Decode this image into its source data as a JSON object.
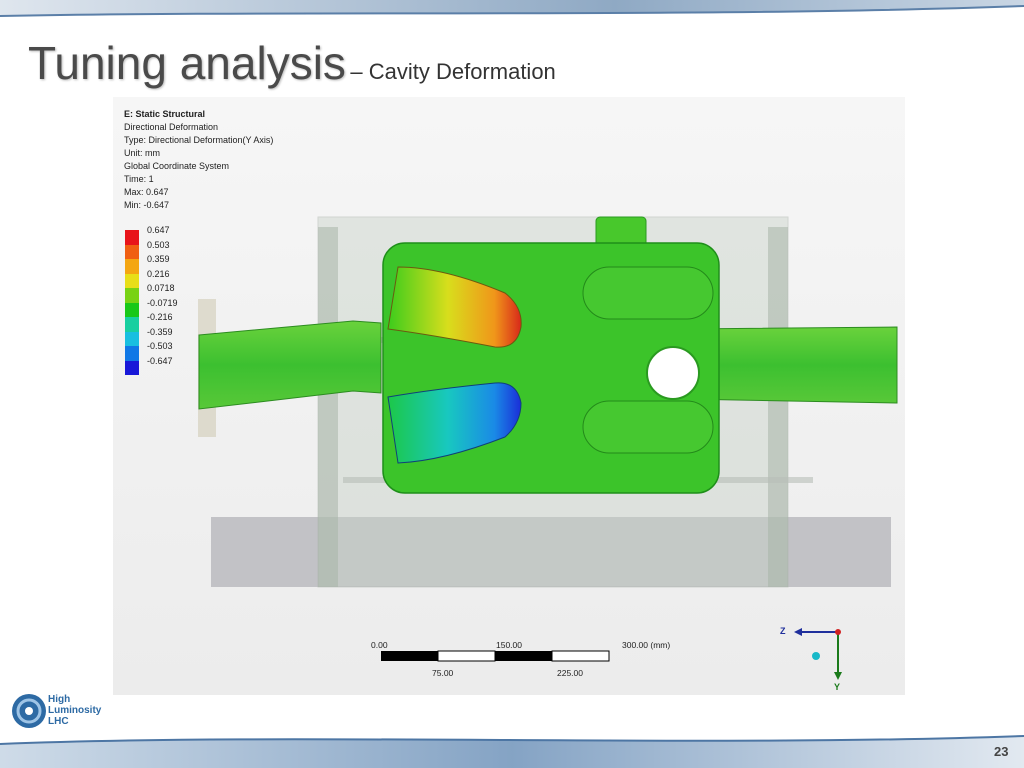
{
  "slide": {
    "title_main": "Tuning analysis",
    "title_sub": "– Cavity Deformation",
    "page_number": "23"
  },
  "simulation_info": {
    "line1": "E: Static Structural",
    "line2": "Directional Deformation",
    "line3": "Type: Directional Deformation(Y Axis)",
    "line4": "Unit: mm",
    "line5": "Global Coordinate System",
    "line6": "Time: 1",
    "line7": "Max: 0.647",
    "line8": "Min: -0.647"
  },
  "legend": {
    "labels": [
      "0.647",
      "0.503",
      "0.359",
      "0.216",
      "0.0718",
      "-0.0719",
      "-0.216",
      "-0.359",
      "-0.503",
      "-0.647"
    ],
    "colors": [
      "#e8141a",
      "#f05f12",
      "#f4a612",
      "#e8de18",
      "#78d214",
      "#18c818",
      "#18cfa0",
      "#18bfe0",
      "#1078e6",
      "#1818d8"
    ]
  },
  "scale_bar": {
    "top_labels": [
      "0.00",
      "150.00",
      "300.00 (mm)"
    ],
    "bottom_labels": [
      "75.00",
      "225.00"
    ]
  },
  "triad": {
    "z_label": "Z",
    "y_label": "Y"
  },
  "logo": {
    "line1": "High",
    "line2": "Luminosity",
    "line3": "LHC"
  }
}
